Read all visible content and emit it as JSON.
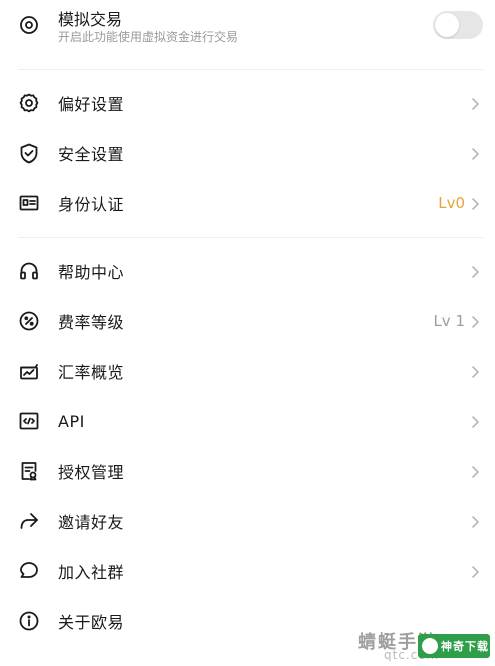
{
  "simulated_trading": {
    "title": "模拟交易",
    "subtitle": "开启此功能使用虚拟资金进行交易",
    "enabled": false
  },
  "group1": [
    {
      "label": "偏好设置",
      "icon": "gear-icon"
    },
    {
      "label": "安全设置",
      "icon": "shield-check-icon"
    },
    {
      "label": "身份认证",
      "icon": "id-card-icon",
      "value": "Lv0"
    }
  ],
  "group2": [
    {
      "label": "帮助中心",
      "icon": "headset-icon"
    },
    {
      "label": "费率等级",
      "icon": "percent-icon",
      "value": "Lv 1"
    },
    {
      "label": "汇率概览",
      "icon": "exchange-chart-icon"
    },
    {
      "label": "API",
      "icon": "code-icon"
    },
    {
      "label": "授权管理",
      "icon": "authorization-doc-icon"
    },
    {
      "label": "邀请好友",
      "icon": "share-arrow-icon"
    },
    {
      "label": "加入社群",
      "icon": "chat-bubble-icon"
    },
    {
      "label": "关于欧易",
      "icon": "info-icon"
    }
  ],
  "colors": {
    "accent_orange": "#e8a33a",
    "toggle_off": "#e6e6e6",
    "chevron": "#b8b8b8"
  },
  "watermark": {
    "text": "蜻蜓手游",
    "url": "qtc.com",
    "badge": "神奇下载"
  }
}
